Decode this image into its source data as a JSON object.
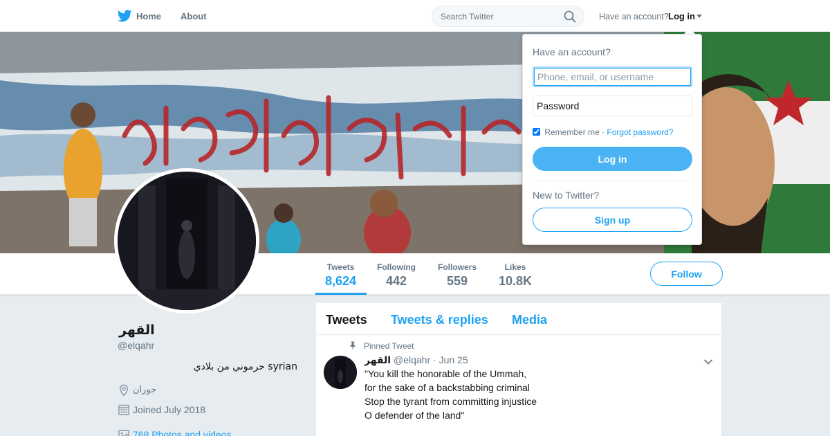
{
  "nav": {
    "home_label": "Home",
    "about_label": "About",
    "search_placeholder": "Search Twitter",
    "have_account": "Have an account?",
    "login_label": "Log in",
    "icons": [
      "twitter-bird-icon",
      "home-icon",
      "search-icon",
      "caret-down-icon"
    ]
  },
  "profile": {
    "name": "القهر",
    "handle": "@elqahr",
    "bio": "حرموني من بلادي syrian",
    "location": "حوران",
    "joined": "Joined July 2018",
    "media_link": "768 Photos and videos"
  },
  "stats": [
    {
      "label": "Tweets",
      "value": "8,624"
    },
    {
      "label": "Following",
      "value": "442"
    },
    {
      "label": "Followers",
      "value": "559"
    },
    {
      "label": "Likes",
      "value": "10.8K"
    }
  ],
  "follow_label": "Follow",
  "timeline": {
    "tabs": [
      "Tweets",
      "Tweets & replies",
      "Media"
    ],
    "pinned_label": "Pinned Tweet",
    "tweet": {
      "name": "القهر",
      "handle": "@elqahr",
      "date": "· Jun 25",
      "lines": [
        "\"You kill the honorable of the Ummah,",
        "for the sake of a backstabbing criminal",
        "Stop the tyrant from committing injustice",
        "O defender of the land\""
      ]
    }
  },
  "login_dropdown": {
    "title": "Have an account?",
    "username_placeholder": "Phone, email, or username",
    "password_placeholder": "Password",
    "remember_label": "Remember me",
    "separator": "·",
    "forgot_label": "Forgot password?",
    "login_button": "Log in",
    "new_label": "New to Twitter?",
    "signup_button": "Sign up"
  },
  "colors": {
    "accent": "#1da1f2",
    "login_button": "#4ab3f4",
    "muted_text": "#657786",
    "page_bg": "#e6ecf0"
  }
}
